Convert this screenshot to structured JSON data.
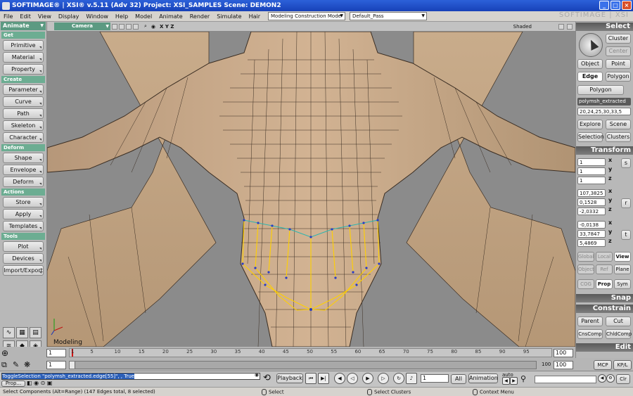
{
  "window": {
    "title": "SOFTIMAGE® | XSI® v.5.11 (Adv 32) Project: XSI_SAMPLES     Scene: DEMON2",
    "brand": "SOFTIMAGE | XSI"
  },
  "menu": {
    "items": [
      "File",
      "Edit",
      "View",
      "Display",
      "Window",
      "Help",
      "Model",
      "Animate",
      "Render",
      "Simulate",
      "Hair"
    ],
    "layout_combo": "Modeling Construction Mode",
    "pass_combo": "Default_Pass"
  },
  "leftbar": {
    "mode": "Animate",
    "sections": [
      {
        "title": "Get",
        "buttons": [
          "Primitive",
          "Material",
          "Property"
        ]
      },
      {
        "title": "Create",
        "buttons": [
          "Parameter",
          "Curve",
          "Path",
          "Skeleton",
          "Character"
        ]
      },
      {
        "title": "Deform",
        "buttons": [
          "Shape",
          "Envelope",
          "Deform"
        ]
      },
      {
        "title": "Actions",
        "buttons": [
          "Store",
          "Apply",
          "Templates"
        ]
      },
      {
        "title": "Tools",
        "buttons": [
          "Plot",
          "Devices",
          "Import/Export"
        ]
      }
    ]
  },
  "viewport": {
    "camera": "Camera",
    "axes": "X Y Z",
    "shading": "Shaded",
    "label": "Modeling",
    "colors": {
      "mesh": "#c4a684",
      "wire": "#3a2d22",
      "selection": "#ffd000",
      "point": "#2a3cc4"
    }
  },
  "rightbar": {
    "select_title": "Select",
    "cluster": "Cluster",
    "center": "Center",
    "object": "Object",
    "point": "Point",
    "edge": "Edge",
    "polygon": "Polygon",
    "polygon2": "Polygon",
    "selection_name": "polymsh_extracted",
    "selection_ids": "20,24,25,30,33,5",
    "explore": "Explore",
    "scene": "Scene",
    "selection": "Selection",
    "clusters": "Clusters",
    "transform_title": "Transform",
    "scale": [
      "1",
      "1",
      "1"
    ],
    "rotate": [
      "107,3825",
      "0,1528",
      "-2,0332"
    ],
    "translate": [
      "-0,0138",
      "33,7847",
      "5,4869"
    ],
    "s_label": "s",
    "r_label": "r",
    "t_label": "t",
    "axis_labels": [
      "x",
      "y",
      "z"
    ],
    "global": "Global",
    "local": "Local",
    "view": "View",
    "object2": "Object",
    "ref": "Ref",
    "plane": "Plane",
    "cog": "COG",
    "prop": "Prop",
    "sym": "Sym",
    "snap_title": "Snap",
    "constrain_title": "Constrain",
    "parent": "Parent",
    "cut": "Cut",
    "cnscomp": "CnsComp",
    "childcomp": "ChldComp",
    "edit_title": "Edit",
    "mcp": "MCP",
    "kpl": "KP/L"
  },
  "timeline": {
    "ticks": [
      "1",
      "5",
      "10",
      "15",
      "20",
      "25",
      "30",
      "35",
      "40",
      "45",
      "50",
      "55",
      "60",
      "65",
      "70",
      "75",
      "80",
      "85",
      "90",
      "95"
    ],
    "start": "1",
    "end": "100",
    "range_start": "1",
    "range_end": "100",
    "range_end2": "100"
  },
  "command": {
    "text": "ToggleSelection \"polymsh_extracted.edge[55]\", , True",
    "prop": "Prop...",
    "playback": "Playback",
    "frame": "1",
    "all": "All",
    "animation": "Animation",
    "auto": "auto",
    "clr": "Clr"
  },
  "status": {
    "message": "Select Components (Alt=Range) (147 Edges total, 8 selected)",
    "left": "Select",
    "middle": "Select Clusters",
    "right": "Context Menu"
  }
}
